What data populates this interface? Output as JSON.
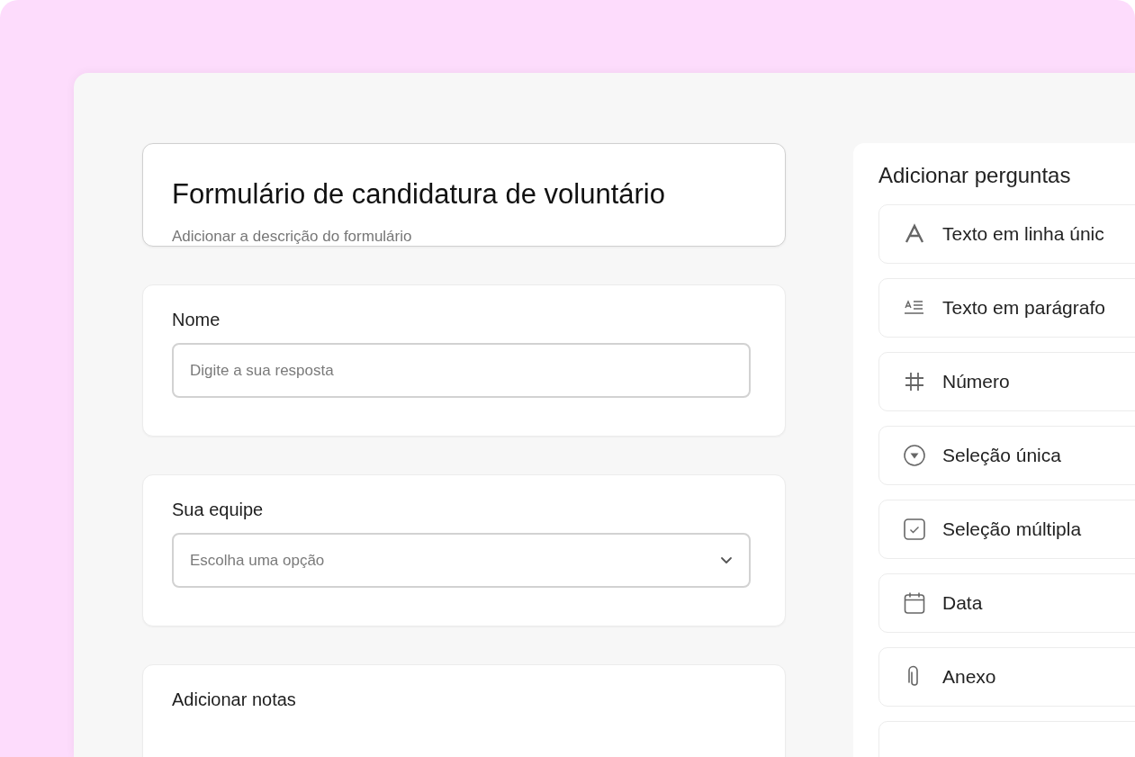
{
  "form": {
    "title": "Formulário de candidatura de voluntário",
    "description": "Adicionar a descrição do formulário",
    "questions": [
      {
        "label": "Nome",
        "kind": "text",
        "placeholder": "Digite a sua resposta"
      },
      {
        "label": "Sua equipe",
        "kind": "select",
        "placeholder": "Escolha uma opção"
      },
      {
        "label": "Adicionar notas",
        "kind": "cut"
      }
    ]
  },
  "add_questions": {
    "heading": "Adicionar perguntas",
    "items": [
      {
        "label": "Texto em linha únic",
        "kind": "single_line"
      },
      {
        "label": "Texto em parágrafo",
        "kind": "paragraph"
      },
      {
        "label": "Número",
        "kind": "number"
      },
      {
        "label": "Seleção única",
        "kind": "single_select"
      },
      {
        "label": "Seleção múltipla",
        "kind": "multi_select"
      },
      {
        "label": "Data",
        "kind": "date"
      },
      {
        "label": "Anexo",
        "kind": "attachment"
      }
    ]
  }
}
